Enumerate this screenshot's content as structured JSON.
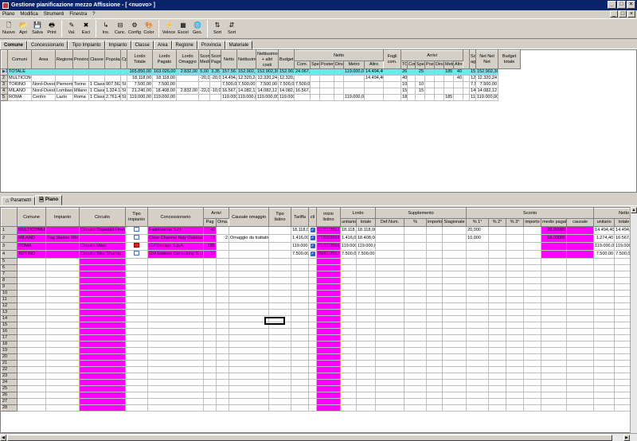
{
  "window": {
    "title": "Gestione pianificazione mezzo Affissione - [ <nuovo> ]",
    "min": "_",
    "max": "□",
    "close": "×"
  },
  "menu": [
    "Piano",
    "Modifica",
    "Strumenti",
    "Finestra",
    "?"
  ],
  "toolbar": [
    {
      "label": "Nuovo",
      "icon": "new-file-icon",
      "glyph": "🗋"
    },
    {
      "label": "Apri",
      "icon": "open-folder-icon",
      "glyph": "📂"
    },
    {
      "label": "Salva",
      "icon": "save-icon",
      "glyph": "💾"
    },
    {
      "label": "Print",
      "icon": "print-icon",
      "glyph": "🖶"
    },
    {
      "label": "Val.",
      "icon": "pencil-icon",
      "glyph": "✎"
    },
    {
      "label": "Esci",
      "icon": "exit-icon",
      "glyph": "✖"
    },
    {
      "label": "Ins.",
      "icon": "insert-icon",
      "glyph": "↳"
    },
    {
      "label": "Canc.",
      "icon": "delete-icon",
      "glyph": "⊟"
    },
    {
      "label": "Config",
      "icon": "config-icon",
      "glyph": "⚙"
    },
    {
      "label": "Color",
      "icon": "palette-icon",
      "glyph": "🎨"
    },
    {
      "label": "Veloce",
      "icon": "lightning-icon",
      "glyph": "⚡"
    },
    {
      "label": "Excel",
      "icon": "excel-icon",
      "glyph": "▦"
    },
    {
      "label": "Geo.",
      "icon": "globe-icon",
      "glyph": "🌐"
    },
    {
      "label": "Sort",
      "icon": "sort-asc-icon",
      "glyph": "⇅"
    },
    {
      "label": "Sort",
      "icon": "sort-desc-icon",
      "glyph": "⇵"
    }
  ],
  "top_tabs": [
    "Comune",
    "Concessionario",
    "Tipo Impianto",
    "Impianto",
    "Classe",
    "Area",
    "Regione",
    "Provincia",
    "Materiale"
  ],
  "grid1": {
    "headers": [
      "Comuni",
      "Area",
      "Regione",
      "Provincia",
      "Classe",
      "Popolaz.",
      "Cp.",
      "Lordo Totale",
      "Lordo Pagato",
      "Lordo Omaggio",
      "Sconto Medio",
      "Sconto Pagat",
      "Netto",
      "Nettissimo",
      "Nettissimo + altri costi",
      "Budget"
    ],
    "group_netto": "Netto",
    "group_netto_sub": [
      "Com.",
      "Spec.",
      "Poster",
      "Dinam.",
      "Metro",
      "Altro"
    ],
    "fogli": "Fogli com.",
    "group_arrivi": "Arrivi",
    "group_arrivi_sub": [
      "TOT.",
      "Com.",
      "Spec.",
      "Poster",
      "Dinam.",
      "Metro",
      "Altro"
    ],
    "sconto_agenzia": "Sconto agenzia",
    "net_net_net": "Net Net Net",
    "budget_totale": "Budget totale",
    "rows": [
      {
        "n": "1",
        "cells": [
          "TOTALE",
          "",
          "",
          "",
          "",
          "",
          "",
          "165.850,00",
          "163.026,00",
          "2.832,00",
          "5,00",
          "3,35",
          "157.561,60",
          "152.902,36",
          "152.902,36",
          "152.902,36",
          "24.067,20",
          "",
          "",
          "",
          "119.000,00",
          "14.494,40",
          "",
          "260",
          "",
          "25",
          "",
          "",
          "185",
          "40",
          "",
          "152.902,36",
          "152.902,36"
        ]
      },
      {
        "n": "2",
        "cells": [
          "MULTICOMUNE",
          "",
          "",
          "",
          "",
          "",
          "",
          "18.118,00",
          "18.118,00",
          "",
          "-20,00",
          "-20,00",
          "14.494,40",
          "12.320,24",
          "12.320,24",
          "12.320,24",
          "",
          "",
          "",
          "",
          "",
          "14.494,40",
          "",
          "40",
          "",
          "",
          "",
          "",
          "",
          "40",
          "",
          "12.320,24",
          "12.320,24"
        ]
      },
      {
        "n": "3",
        "cells": [
          "TORINO",
          "Nord-Ovest",
          "Piemonte",
          "Torino",
          "1 Classe",
          "907.563",
          "SI",
          "7.500,00",
          "7.500,00",
          "",
          "",
          "",
          "7.500,00",
          "7.500,00",
          "7.500,00",
          "7.500,00",
          "7.500,00",
          "",
          "",
          "",
          "",
          "",
          "",
          "10",
          "",
          "10",
          "",
          "",
          "",
          "",
          "",
          "7.500,00",
          "7.500,00"
        ]
      },
      {
        "n": "4",
        "cells": [
          "MILANO",
          "Nord-Ovest",
          "Lombardia",
          "Milano",
          "1 Classe",
          "1.324.110",
          "SI",
          "21.240,00",
          "18.408,00",
          "2.832,00",
          "-22,00",
          "-10,00",
          "16.567,20",
          "14.082,12",
          "14.082,12",
          "14.082,12",
          "16.567,20",
          "",
          "",
          "",
          "",
          "",
          "",
          "15",
          "",
          "15",
          "",
          "",
          "",
          "",
          "",
          "14.082,12",
          "14.082,12"
        ]
      },
      {
        "n": "5",
        "cells": [
          "ROMA",
          "Centro",
          "Lazio",
          "Roma",
          "1 Classe",
          "2.761.477",
          "SI",
          "119.000,00",
          "119.000,00",
          "",
          "",
          "",
          "119.000,00",
          "119.000,00",
          "119.000,00",
          "119.000,00",
          "",
          "",
          "",
          "",
          "119.000,00",
          "",
          "",
          "185",
          "",
          "",
          "",
          "",
          "185",
          "",
          "",
          "119.000,00",
          "119.000,00"
        ]
      }
    ]
  },
  "bottom_tabs": [
    {
      "label": "Parametri",
      "icon": "house-icon",
      "glyph": "⌂"
    },
    {
      "label": "Piano",
      "icon": "document-icon",
      "glyph": "🗎"
    }
  ],
  "grid2": {
    "h_top": [
      "Comune",
      "Impianto",
      "Circuito",
      "Tipo impianto",
      "Concessionario",
      "Arrivi",
      "Causale omaggio",
      "Tipo listino",
      "Tariffa",
      "ctl",
      "inizio listino",
      "Lordo",
      "Supplemento",
      "Sconto",
      "Netto"
    ],
    "arrivi_sub": [
      "Pag",
      "Oma."
    ],
    "lordo_sub": [
      "unitario",
      "totale"
    ],
    "supp_sub": [
      "Def.Num.",
      "%",
      "importo",
      "Stagionale"
    ],
    "sconto_sub": [
      "% 1°",
      "% 2°",
      "% 3°",
      "importo",
      "medio pagato",
      "causale"
    ],
    "netto_sub": [
      "unitario",
      "totale",
      "15,"
    ],
    "rows": [
      {
        "n": "1",
        "comune": "MULTICOMUNE",
        "impianto": "",
        "circuito": "Circuito Ospedali Firenze",
        "tipo": "blue",
        "conc": "Fast4Venue S.r.l.",
        "pag": "40",
        "oma": "",
        "causale": "",
        "tlist": "",
        "tariffa": "18.118,00",
        "inizio": "01/01/2017",
        "lunit": "18.118,00",
        "ltot": "18.118,00",
        "s1": "20,000",
        "smedio": "20,00000",
        "nunit": "14.494,40",
        "ntot": "14.494,40",
        "n15": "15,"
      },
      {
        "n": "2",
        "comune": "MILANO",
        "impianto": "Bag Station 90x70",
        "circuito": "",
        "tipo": "blue",
        "conc": "Clear Channel Italy Outdoor S.r.l.",
        "pag": "13",
        "oma": "2",
        "causale": "Omaggio da trattativa",
        "tlist": "",
        "tariffa": "1.416,00",
        "inizio": "07/03/2016",
        "lunit": "1.416,00",
        "ltot": "18.408,00",
        "s1": "10,000",
        "smedio": "10,00000",
        "nunit": "1.274,40",
        "ntot": "16.567,20",
        "n15": "15,"
      },
      {
        "n": "3",
        "comune": "ROMA",
        "impianto": "",
        "circuito": "Circuito Maxi",
        "tipo": "red",
        "conc": "IGPDecaux S.p.A.",
        "pag": "185",
        "oma": "",
        "causale": "",
        "tlist": "",
        "tariffa": "119.000,00",
        "inizio": "01/01/2016",
        "lunit": "119.000,00",
        "ltot": "119.000,00",
        "s1": "",
        "smedio": "",
        "nunit": "119.000,00",
        "ntot": "119.000,00",
        "n15": "15,"
      },
      {
        "n": "4",
        "comune": "TORINO",
        "impianto": "",
        "circuito": "Circuito Bike Sharing",
        "tipo": "blue",
        "conc": "GM Esterne Consulting S.r.l.",
        "pag": "10",
        "oma": "",
        "causale": "",
        "tlist": "",
        "tariffa": "7.500,00",
        "inizio": "09/01/2017",
        "lunit": "7.500,00",
        "ltot": "7.500,00",
        "s1": "",
        "smedio": "",
        "nunit": "7.500,00",
        "ntot": "7.500,00",
        "n15": "15,"
      }
    ],
    "empty_rows": [
      "5",
      "6",
      "7",
      "8",
      "9",
      "10",
      "11",
      "12",
      "13",
      "14",
      "15",
      "16",
      "17",
      "18",
      "19",
      "20",
      "21",
      "22",
      "23",
      "24",
      "25",
      "26",
      "27",
      "28"
    ]
  },
  "colors": {
    "highlight": "#ff00ff",
    "total": "#6fe8ec",
    "titlebar": "#0a246a"
  }
}
